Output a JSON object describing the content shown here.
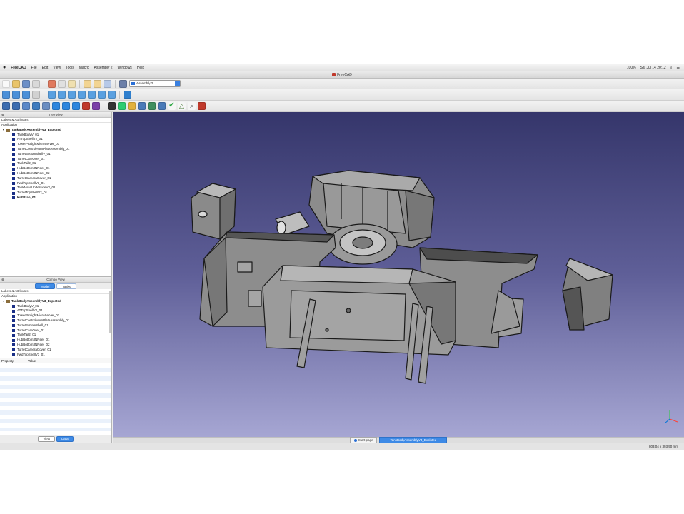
{
  "menubar": {
    "app_name": "FreeCAD",
    "items": [
      "File",
      "Edit",
      "View",
      "Tools",
      "Macro",
      "Assembly 2",
      "Windows",
      "Help"
    ],
    "battery": "100%",
    "clock": "Sat Jul 14  20:12"
  },
  "window": {
    "title": "FreeCAD"
  },
  "toolbar": {
    "workbench": "Assembly 2"
  },
  "tree_panel": {
    "title": "Tree view",
    "labels_header": "Labels & Attributes",
    "application": "Application",
    "root": "TankBodyAssemblyV3_Exploted",
    "items": [
      {
        "label": "TankBodyV_01",
        "bold": false
      },
      {
        "label": "ATTopShellV2_01",
        "bold": false
      },
      {
        "label": "TowerProtightMicroServer_01",
        "bold": false
      },
      {
        "label": "TurretControlHornPlateAssembly_01",
        "bold": false
      },
      {
        "label": "TurretBottomShellV_01",
        "bold": false
      },
      {
        "label": "TurretCamOver_01",
        "bold": false
      },
      {
        "label": "TankTail2_01",
        "bold": false
      },
      {
        "label": "HubBottom3NReer_01",
        "bold": false
      },
      {
        "label": "HubBottom3NReer_02",
        "bold": false
      },
      {
        "label": "TurretCameraCover_01",
        "bold": false
      },
      {
        "label": "FwdTopShellV3_01",
        "bold": false
      },
      {
        "label": "TankNoseUndersideV2_01",
        "bold": false
      },
      {
        "label": "TurretTopShellV2_01",
        "bold": false
      },
      {
        "label": "KillStrap_01",
        "bold": true
      }
    ]
  },
  "combo_panel": {
    "title": "Combo View",
    "tabs": [
      "Model",
      "Tasks"
    ],
    "labels_header": "Labels & Attributes",
    "application": "Application",
    "root": "TankBodyAssemblyV3_Exploted",
    "items": [
      "TankBodyV_01",
      "ATTopShellV2_01",
      "TowerProtightMicroServer_01",
      "TurretControlHornPlateAssembly_01",
      "TurretBottomShell_01",
      "TurretCamOver_01",
      "TankTail2_01",
      "HubBottom3NReer_01",
      "HubBottom3NReer_02",
      "TurretCameraCover_01",
      "FwdTopShellV3_01"
    ],
    "property_col": "Property",
    "value_col": "Value",
    "view_btn": "View",
    "data_btn": "Data"
  },
  "doc_tabs": {
    "start": "Start page",
    "active": "TankBodyAssemblyV3_Exploted"
  },
  "statusbar": {
    "dims": "803.04 x 393.90 mm"
  },
  "colors": {
    "accent": "#3d8ae6",
    "tree_bullet": "#1a2f86"
  },
  "icons": [
    "apple-icon",
    "new-icon",
    "open-icon",
    "save-icon",
    "zoom-icon",
    "part-icon",
    "check-icon"
  ]
}
